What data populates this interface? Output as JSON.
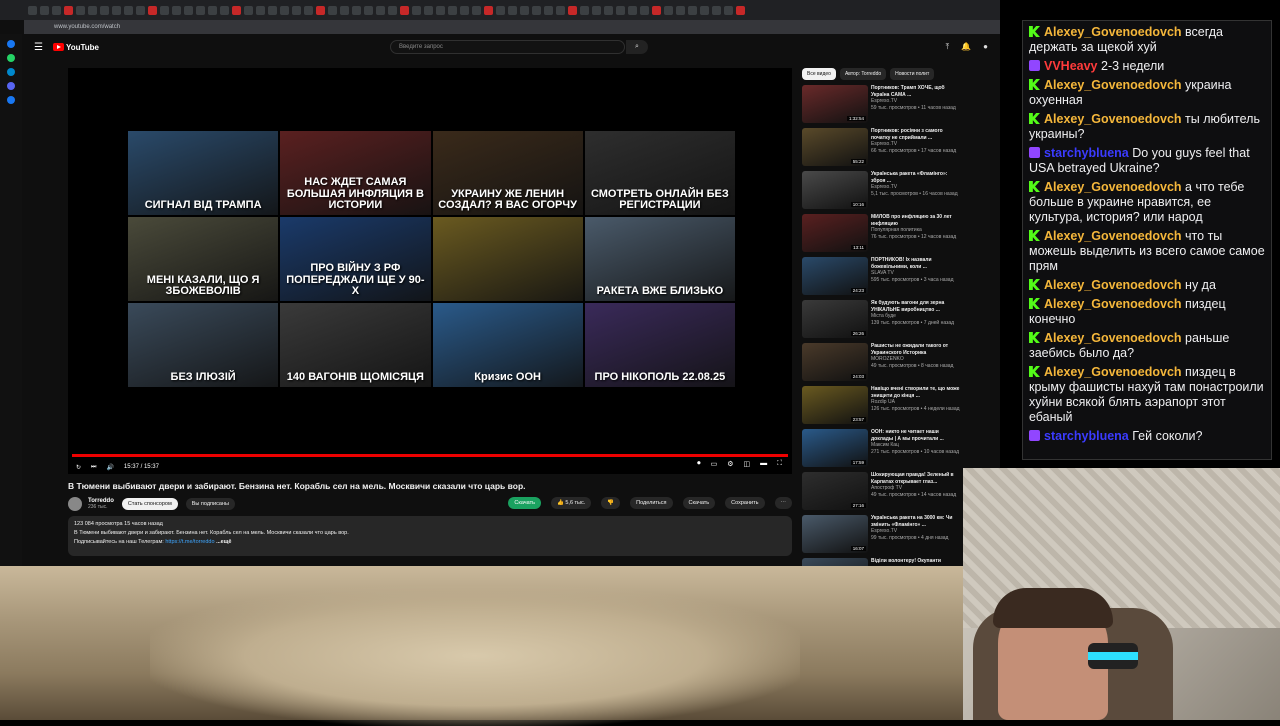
{
  "browser": {
    "url": "www.youtube.com/watch"
  },
  "youtube": {
    "logo": "YouTube",
    "search_placeholder": "Введите запрос"
  },
  "grid": [
    {
      "text": "СИГНАЛ ВІД ТРАМПА",
      "color": "#2a4a6a"
    },
    {
      "text": "НАС ЖДЕТ САМАЯ БОЛЬШАЯ ИНФЛЯЦИЯ В ИСТОРИИ",
      "color": "#5a2020"
    },
    {
      "text": "УКРАИНУ ЖЕ ЛЕНИН СОЗДАЛ? Я ВАС ОГОРЧУ",
      "color": "#3a2a1a"
    },
    {
      "text": "СМОТРЕТЬ ОНЛАЙН БЕЗ РЕГИСТРАЦИИ",
      "color": "#2e2e2e"
    },
    {
      "text": "МЕНІ КАЗАЛИ, ЩО Я ЗБОЖЕВОЛІВ",
      "color": "#4a4a3a"
    },
    {
      "text": "ПРО ВІЙНУ З РФ ПОПЕРЕДЖАЛИ ЩЕ У 90-Х",
      "color": "#1a3a6a"
    },
    {
      "text": "",
      "color": "#6a5a20"
    },
    {
      "text": "РАКЕТА ВЖЕ БЛИЗЬКО",
      "color": "#4a5a6a"
    },
    {
      "text": "БЕЗ ІЛЮЗІЙ",
      "color": "#3a4a5a"
    },
    {
      "text": "140 ВАГОНІВ ЩОМІСЯЦЯ",
      "color": "#3a3a3a"
    },
    {
      "text": "Кризис ООН",
      "color": "#2a5a8a"
    },
    {
      "text": "ПРО НІКОПОЛЬ 22.08.25",
      "color": "#3a2a5a"
    }
  ],
  "player": {
    "time": "15:37 / 15:37"
  },
  "video": {
    "title": "В Тюмени выбивают двери и забирают. Бензина нет. Корабль сел на мель. Москвичи сказали что царь вор.",
    "channel": "Torreddo",
    "subs": "236 тыс.",
    "sponsor": "Стать спонсором",
    "subscribed": "Вы подписаны",
    "download": "Скачать",
    "likes": "5,6 тыс.",
    "share": "Поделиться",
    "download2": "Скачать",
    "save": "Сохранить",
    "views": "123 084 просмотра  15 часов назад",
    "desc": "В Тюмени выбивают двери и забирают. Бензина нет. Корабль сел на мель. Москвичи сказали что царь вор.",
    "tg_prefix": "Подписывайтесь на наш Телеграм:",
    "tg_link": "https://t.me/torreddo",
    "more": "...ещё"
  },
  "chips": [
    "Все видео",
    "Автор: Torreddo",
    "Новости полит"
  ],
  "related": [
    {
      "title": "Портников: Трамп ХОЧЕ, щоб Україна САМА ...",
      "channel": "Espreso.TV",
      "meta": "59 тыс. просмотров • 11 часов назад",
      "dur": "1:32:54",
      "color": "#6a2a2a"
    },
    {
      "title": "Портников: росіяни з самого початку не сприймали ...",
      "channel": "Espreso.TV",
      "meta": "66 тыс. просмотров • 17 часов назад",
      "dur": "55:22",
      "color": "#5a4a2a"
    },
    {
      "title": "Українська ракета «Фламінго»: зброя ...",
      "channel": "Espreso.TV",
      "meta": "5,1 тыс. просмотров • 16 часов назад",
      "dur": "10:16",
      "color": "#4a4a4a"
    },
    {
      "title": "МИЛОВ про инфляцию за 30 лет инфляцию",
      "channel": "Популярная политика",
      "meta": "76 тыс. просмотров • 12 часов назад",
      "dur": "13:11",
      "color": "#5a2020"
    },
    {
      "title": "ПОРТНИКОВ! Їх назвали божевільними, коли ...",
      "channel": "SLAVA TV",
      "meta": "595 тыс. просмотров • 3 часа назад",
      "dur": "24:23",
      "color": "#2a4a6a"
    },
    {
      "title": "Як будують вагони для зерна УНІКАЛЬНЕ виробництво ...",
      "channel": "Міста буде",
      "meta": "139 тыс. просмотров • 7 дней назад",
      "dur": "26:26",
      "color": "#3a3a3a"
    },
    {
      "title": "Рашисты не ожидали такого от Украинского Историка",
      "channel": "MOROZENKO",
      "meta": "49 тыс. просмотров • 8 часов назад",
      "dur": "24:03",
      "color": "#4a3a2a"
    },
    {
      "title": "Навіщо вчені створили те, що може знищити до кінця ...",
      "channel": "Rozdip UA",
      "meta": "126 тыс. просмотров • 4 недели назад",
      "dur": "23:57",
      "color": "#6a5a20"
    },
    {
      "title": "ООН: никто не читает наши доклады | А мы прочитали ...",
      "channel": "Максим Кац",
      "meta": "271 тыс. просмотров • 10 часов назад",
      "dur": "17:59",
      "color": "#2a5a8a"
    },
    {
      "title": "Шокирующая правда! Зеленый в Карпатах открывает глаз...",
      "channel": "Апостроф TV",
      "meta": "49 тыс. просмотров • 14 часов назад",
      "dur": "27:16",
      "color": "#2e2e2e"
    },
    {
      "title": "Українська ракета на 3000 км: Чи змінить «Фламінго» ...",
      "channel": "Espreso.TV",
      "meta": "99 тыс. просмотров • 4 дня назад",
      "dur": "16:07",
      "color": "#4a5a6a"
    },
    {
      "title": "Віділи волонтеру! Окупанти",
      "channel": "",
      "meta": "",
      "dur": "",
      "color": "#3a4a5a"
    }
  ],
  "chat": [
    {
      "badge": "kick",
      "user": "Alexey_Govenoedovch",
      "color": "#f5b73b",
      "text": "всегда держать за щекой хуй"
    },
    {
      "badge": "tw",
      "user": "VVHeavy",
      "color": "#ff3b3b",
      "text": "2-3 недели"
    },
    {
      "badge": "kick",
      "user": "Alexey_Govenoedovch",
      "color": "#f5b73b",
      "text": "украина охуенная"
    },
    {
      "badge": "kick",
      "user": "Alexey_Govenoedovch",
      "color": "#f5b73b",
      "text": "ты любитель украины?"
    },
    {
      "badge": "tw",
      "user": "starchybluena",
      "color": "#3b3bff",
      "text": "Do you guys feel that USA betrayed Ukraine?"
    },
    {
      "badge": "kick",
      "user": "Alexey_Govenoedovch",
      "color": "#f5b73b",
      "text": "а что тебе больше в украине нравится, ее культура, история? или народ"
    },
    {
      "badge": "kick",
      "user": "Alexey_Govenoedovch",
      "color": "#f5b73b",
      "text": "что ты можешь выделить из всего самое самое прям"
    },
    {
      "badge": "kick",
      "user": "Alexey_Govenoedovch",
      "color": "#f5b73b",
      "text": "ну да"
    },
    {
      "badge": "kick",
      "user": "Alexey_Govenoedovch",
      "color": "#f5b73b",
      "text": "пиздец конечно"
    },
    {
      "badge": "kick",
      "user": "Alexey_Govenoedovch",
      "color": "#f5b73b",
      "text": "раньше заебись было да?"
    },
    {
      "badge": "kick",
      "user": "Alexey_Govenoedovch",
      "color": "#f5b73b",
      "text": "пиздец в крыму фашисты нахуй там понастроили хуйни всякой блять аэрапорт этот ебаный"
    },
    {
      "badge": "tw",
      "user": "starchybluena",
      "color": "#3b3bff",
      "text": "Гей соколи?"
    }
  ]
}
